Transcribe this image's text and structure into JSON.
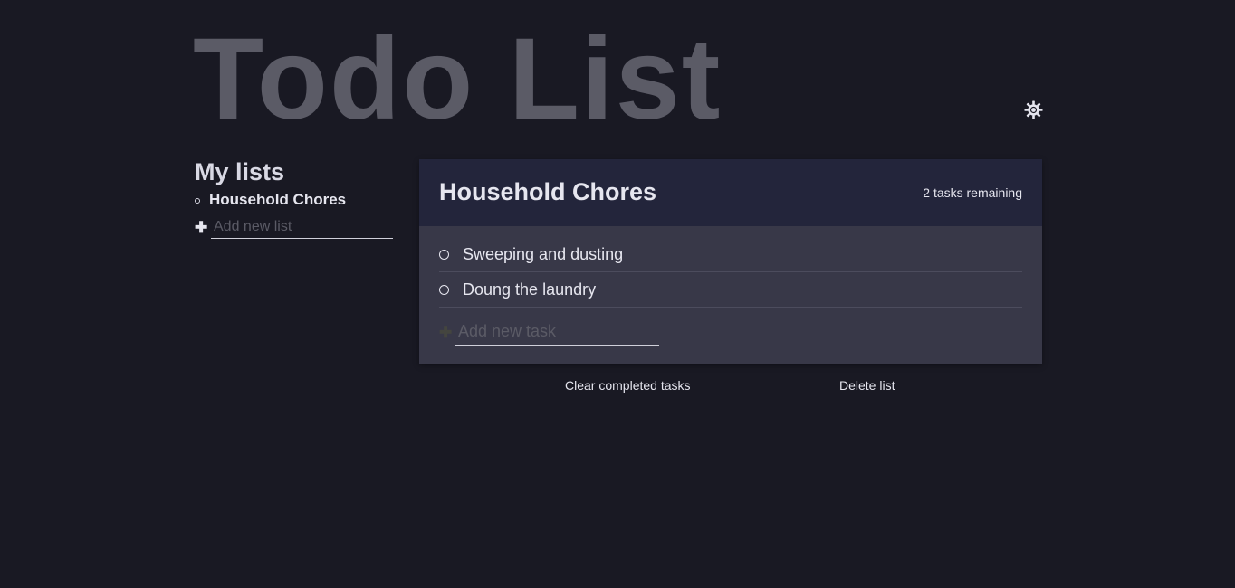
{
  "app": {
    "title": "Todo List",
    "theme_icon": "sun-icon"
  },
  "sidebar": {
    "title": "My lists",
    "lists": [
      {
        "label": "Household Chores",
        "active": true
      }
    ],
    "new_list_placeholder": "Add new list",
    "new_list_icon": "plus-icon"
  },
  "main": {
    "list_title": "Household Chores",
    "task_count": "2 tasks remaining",
    "tasks": [
      {
        "label": "Sweeping and dusting",
        "completed": false
      },
      {
        "label": "Doung the laundry",
        "completed": false
      }
    ],
    "new_task_placeholder": "Add new task",
    "new_task_icon": "plus-icon"
  },
  "actions": {
    "clear_completed": "Clear completed tasks",
    "delete_list": "Delete list"
  },
  "colors": {
    "background": "#191923",
    "panel_header": "#23253b",
    "panel_body": "#383848",
    "title_text": "#5b5b66",
    "text": "#e6e6ef"
  }
}
